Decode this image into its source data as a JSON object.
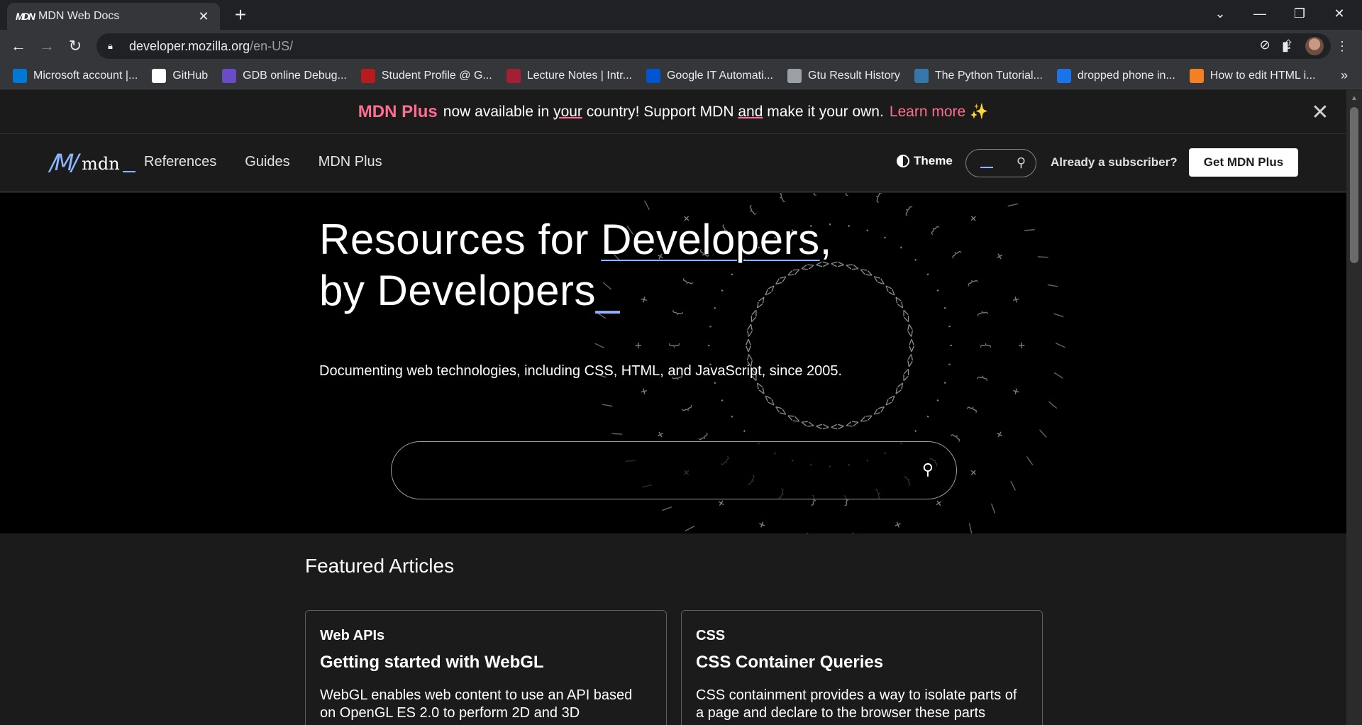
{
  "browser": {
    "tab_title": "MDN Web Docs",
    "tab_favicon": "MDN",
    "url_host": "developer.mozilla.org",
    "url_path": "/en-US/",
    "bookmarks": [
      {
        "label": "Microsoft account |...",
        "icon": "windows-icon",
        "color": "#0078d4"
      },
      {
        "label": "GitHub",
        "icon": "github-icon",
        "color": "#ffffff"
      },
      {
        "label": "GDB online Debug...",
        "icon": "bolt-icon",
        "color": "#6a4cc7"
      },
      {
        "label": "Student Profile @ G...",
        "icon": "school-icon",
        "color": "#b71c1c"
      },
      {
        "label": "Lecture Notes | Intr...",
        "icon": "mit-icon",
        "color": "#a31f34"
      },
      {
        "label": "Google IT Automati...",
        "icon": "coursera-icon",
        "color": "#0056d2"
      },
      {
        "label": "Gtu Result History",
        "icon": "globe-icon",
        "color": "#9aa0a6"
      },
      {
        "label": "The Python Tutorial...",
        "icon": "python-icon",
        "color": "#3776ab"
      },
      {
        "label": "dropped phone in...",
        "icon": "x-circle-icon",
        "color": "#1a73e8"
      },
      {
        "label": "How to edit HTML i...",
        "icon": "stackoverflow-icon",
        "color": "#f48024"
      }
    ]
  },
  "banner": {
    "plus": "MDN Plus",
    "text1": "now available in",
    "your": "your",
    "text2": "country! Support MDN",
    "and": "and",
    "text3": "make it your own.",
    "learn": "Learn more",
    "sparkle": "✨"
  },
  "header": {
    "logo_mark": "/M/",
    "logo_text": "mdn",
    "nav": [
      "References",
      "Guides",
      "MDN Plus"
    ],
    "theme": "Theme",
    "subscriber": "Already a subscriber?",
    "get_plus": "Get MDN Plus"
  },
  "hero": {
    "title_a": "Resources for ",
    "title_u": "Developers",
    "title_b": ",",
    "title_line2": "by Developers",
    "title_cursor": "_",
    "subtitle": "Documenting web technologies, including CSS, HTML, and JavaScript, since 2005."
  },
  "featured": {
    "heading": "Featured Articles",
    "cards": [
      {
        "category": "Web APIs",
        "title": "Getting started with WebGL",
        "desc": "WebGL enables web content to use an API based on OpenGL ES 2.0 to perform 2D and 3D"
      },
      {
        "category": "CSS",
        "title": "CSS Container Queries",
        "desc": "CSS containment provides a way to isolate parts of a page and declare to the browser these parts"
      }
    ]
  },
  "colors": {
    "accent_blue": "#8cb4ff",
    "accent_pink": "#ff6d91"
  }
}
